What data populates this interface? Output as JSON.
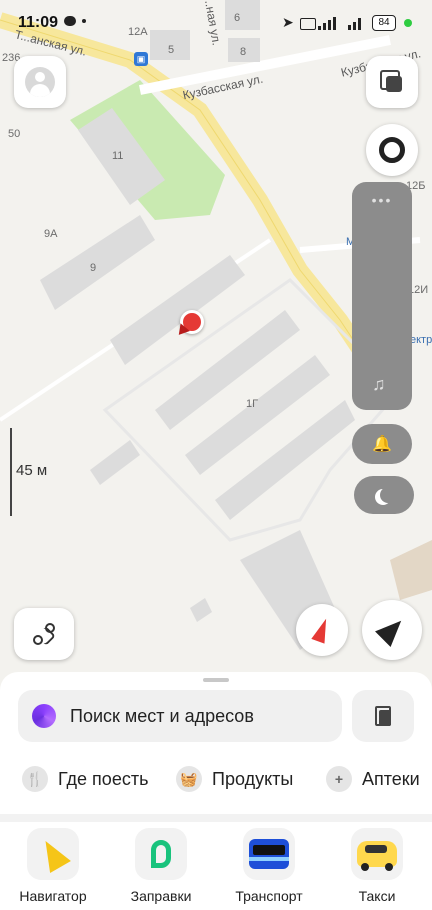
{
  "status_bar": {
    "time": "11:09",
    "battery": "84"
  },
  "map": {
    "streets": {
      "top_left": "Т...анская ул.",
      "kuzbasskaya_1": "Кузбасская ул.",
      "kuzbasskaya_2": "Кузбасская ул.",
      "vertical": "...ная ул."
    },
    "house_numbers": [
      "12А",
      "5",
      "6",
      "8",
      "236",
      "50",
      "11",
      "9А",
      "9",
      "1Г",
      "12Б",
      "12И"
    ],
    "partial_labels": {
      "metro": "М...л",
      "right_edge": "ектр"
    },
    "scale": "45 м"
  },
  "side_panel": {
    "dots": "•••"
  },
  "search": {
    "placeholder": "Поиск мест и адресов"
  },
  "categories": [
    {
      "label": "Где поесть",
      "icon": "fork-knife-icon"
    },
    {
      "label": "Продукты",
      "icon": "basket-icon"
    },
    {
      "label": "Аптеки",
      "icon": "plus-icon"
    }
  ],
  "apps": [
    {
      "label": "Навигатор",
      "icon": "navigator-icon"
    },
    {
      "label": "Заправки",
      "icon": "fuel-icon"
    },
    {
      "label": "Транспорт",
      "icon": "bus-icon"
    },
    {
      "label": "Такси",
      "icon": "taxi-icon"
    }
  ],
  "colors": {
    "accent": "#ffd84d",
    "road": "#f7e79c",
    "building": "#dcdcdc",
    "park": "#c9eab1",
    "marker": "#e53935"
  }
}
